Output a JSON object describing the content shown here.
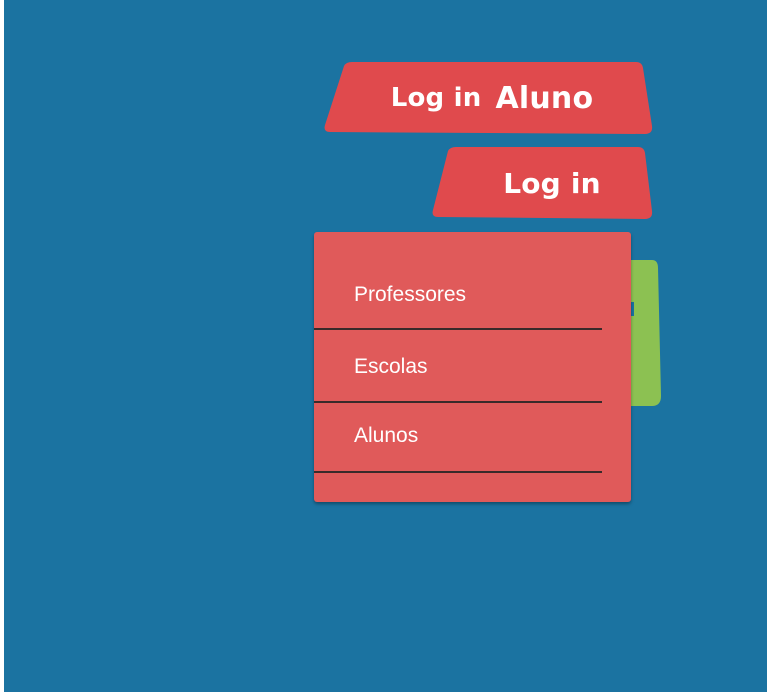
{
  "buttons": {
    "login_aluno": {
      "part1": "Log in",
      "part2": "Aluno"
    },
    "login": {
      "label": "Log in"
    }
  },
  "menu": {
    "items": [
      {
        "label": "Professores"
      },
      {
        "label": "Escolas"
      },
      {
        "label": "Alunos"
      }
    ]
  },
  "colors": {
    "background": "#1b73a1",
    "button": "#e04a4d",
    "menu": "#e05a5a",
    "accent_green": "#8cc152"
  }
}
